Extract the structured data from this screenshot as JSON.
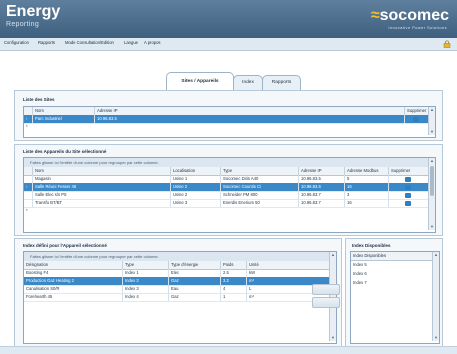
{
  "header": {
    "app_title": "Energy",
    "app_subtitle": "Reporting",
    "logo_text": "socomec",
    "logo_tagline": "Innovative Power Solutions"
  },
  "menu": {
    "items": [
      "Configuration",
      "Rapports",
      "Mode Consultation/Edition",
      "Langue",
      "A propos"
    ]
  },
  "tabs": [
    {
      "label": "Sites / Appareils",
      "active": true
    },
    {
      "label": "Index",
      "active": false
    },
    {
      "label": "Rapports",
      "active": false
    }
  ],
  "sites_panel": {
    "title": "Liste des Sites",
    "columns": [
      "Nom",
      "Adresse IP",
      "Supprimer"
    ],
    "rows": [
      {
        "nom": "Parc Industriel",
        "ip": "10.96.83.5",
        "selected": true
      }
    ]
  },
  "devices_panel": {
    "title": "Liste des Appareils du Site sélectionné",
    "group_hint": "Faites glisser ici l'entête d'une colonne pour regrouper par cette colonne.",
    "columns": [
      "Nom",
      "Localisation",
      "Type",
      "Adresse IP",
      "Adresse Modbus",
      "Supprimer"
    ],
    "rows": [
      {
        "nom": "Magasin",
        "loc": "Usine 1",
        "type": "Socomec Diris A40",
        "ip": "10.96.83.5",
        "modbus": "5",
        "selected": false
      },
      {
        "nom": "Salle Réuni Fesser 46",
        "loc": "Usine 2",
        "type": "Socomec Countis Ci",
        "ip": "10.96.83.6",
        "modbus": "16",
        "selected": true
      },
      {
        "nom": "Salle Elec s/s P5",
        "loc": "Usine 2",
        "type": "Schneider PM 800",
        "ip": "10.96.83.7",
        "modbus": "3",
        "selected": false
      },
      {
        "nom": "Transfo BT/BT",
        "loc": "Usine 3",
        "type": "Enerdis Enerium 50",
        "ip": "10.96.83.7",
        "modbus": "16",
        "selected": false
      }
    ]
  },
  "index_panel": {
    "title": "Index défini pour l'Appareil sélectionné",
    "group_hint": "Faites glisser ici l'entête d'une colonne pour regrouper par cette colonne.",
    "columns": [
      "Désignation",
      "Type",
      "Type d'énergie",
      "Poids",
      "Unité"
    ],
    "rows": [
      {
        "des": "Boosting F4",
        "type": "Index 1",
        "energie": "Elec",
        "poids": "2.5",
        "unite": "kW",
        "selected": false
      },
      {
        "des": "Production Gaz Heating 2",
        "type": "Index 2",
        "energie": "Gaz",
        "poids": "3.2",
        "unite": "m³",
        "selected": true
      },
      {
        "des": "Canalisation S0/R",
        "type": "Index 3",
        "energie": "Eau",
        "poids": "4",
        "unite": "L",
        "selected": false
      },
      {
        "des": "Forehearth 45",
        "type": "Index 4",
        "energie": "Gaz",
        "poids": "1",
        "unite": "m³",
        "selected": false
      }
    ]
  },
  "available_panel": {
    "title": "Index Disponibles",
    "header": "Index Disponibles",
    "items": [
      "Index 5",
      "Index 6",
      "Index 7"
    ]
  },
  "colors": {
    "header": "#4c6c8c",
    "accent": "#f3c02a",
    "selected_row": "#3b88c9"
  }
}
